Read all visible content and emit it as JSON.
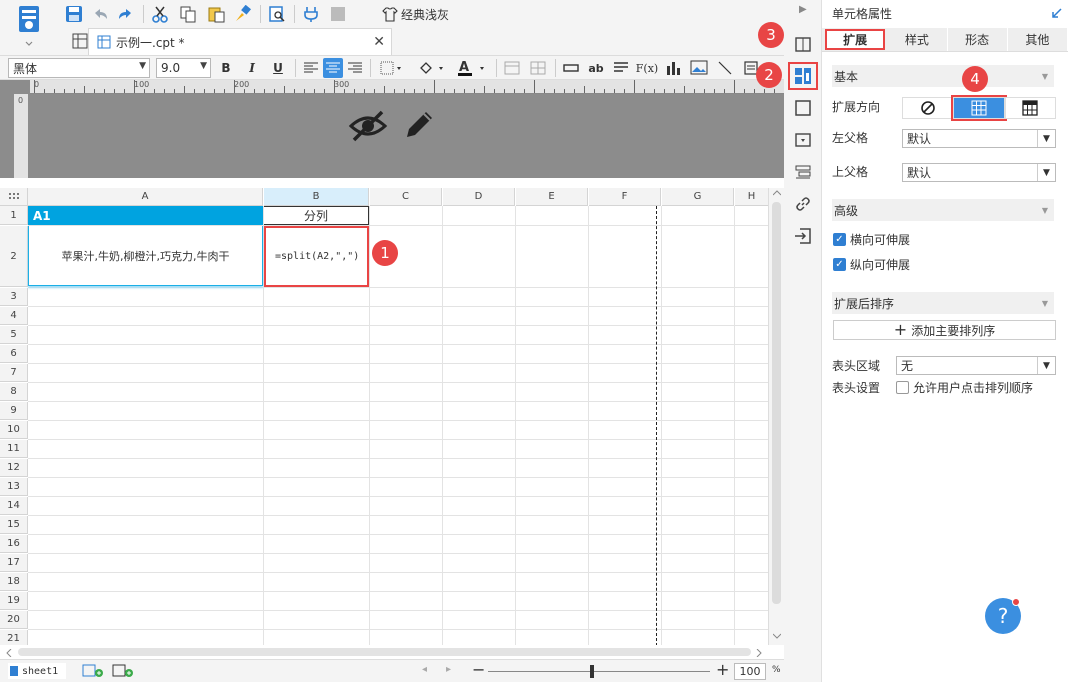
{
  "toolbar": {
    "theme_label": "经典浅灰"
  },
  "doc_tab": {
    "title": "示例一.cpt *"
  },
  "format": {
    "font_name": "黑体",
    "font_size": "9.0",
    "bold": "B",
    "italic": "I",
    "underline": "U"
  },
  "ruler": {
    "marks": [
      "0",
      "100",
      "200",
      "300"
    ]
  },
  "grid": {
    "columns": [
      "A",
      "B",
      "C",
      "D",
      "E",
      "F",
      "G",
      "H"
    ],
    "rows": [
      "1",
      "2",
      "3",
      "4",
      "5",
      "6",
      "7",
      "8",
      "9",
      "10",
      "11",
      "12",
      "13",
      "14",
      "15",
      "16",
      "17",
      "18",
      "19",
      "20",
      "21"
    ],
    "a1_label": "A1",
    "a2_value": "苹果汁,牛奶,柳橙汁,巧克力,牛肉干",
    "b1_value": "分列",
    "b2_formula": "=split(A2,\",\")"
  },
  "badges": {
    "b1": "1",
    "b2": "2",
    "b3": "3",
    "b4": "4"
  },
  "status": {
    "sheet_name": "sheet1",
    "zoom": "100",
    "zoom_unit": "%"
  },
  "panel": {
    "title": "单元格属性",
    "tabs": [
      "扩展",
      "样式",
      "形态",
      "其他"
    ],
    "section_basic": "基本",
    "expand_dir_label": "扩展方向",
    "left_parent_label": "左父格",
    "left_parent_value": "默认",
    "top_parent_label": "上父格",
    "top_parent_value": "默认",
    "section_advanced": "高级",
    "h_expand": "横向可伸展",
    "v_expand": "纵向可伸展",
    "section_sort": "扩展后排序",
    "add_sort": "添加主要排列序",
    "header_area_label": "表头区域",
    "header_area_value": "无",
    "header_setting_label": "表头设置",
    "allow_user_sort": "允许用户点击排列顺序",
    "help": "?"
  },
  "colors": {
    "accent": "#3b8fe0",
    "highlight_red": "#e94444",
    "cell_blue": "#00a3e0"
  }
}
